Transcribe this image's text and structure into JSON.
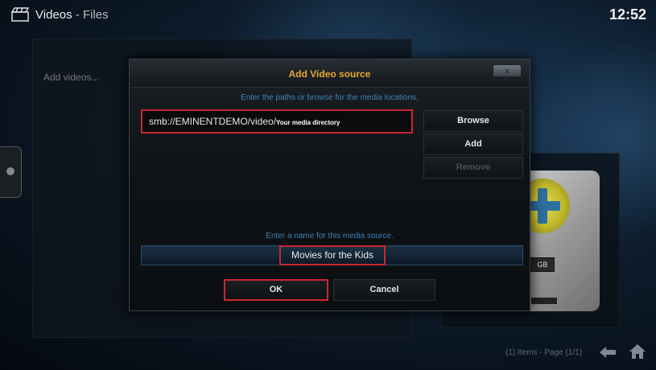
{
  "header": {
    "section": "Videos",
    "separator": " - ",
    "subsection": "Files",
    "clock": "12:52"
  },
  "left_panel": {
    "hint": "Add videos..."
  },
  "right_card": {
    "drive_label": "GB"
  },
  "footer": {
    "items_info": "(1) Items - Page (1/1)"
  },
  "dialog": {
    "title": "Add Video source",
    "close_label": "x",
    "instructions": "Enter the paths or browse for the media locations.",
    "path_value": "smb://EMINENTDEMO/video/",
    "path_annotation": "Your media directory",
    "browse_label": "Browse",
    "add_label": "Add",
    "remove_label": "Remove",
    "name_instructions": "Enter a name for this media source.",
    "name_value": "Movies for the Kids",
    "ok_label": "OK",
    "cancel_label": "Cancel"
  },
  "colors": {
    "accent": "#e8a732",
    "highlight": "#c8282e",
    "instruction_text": "#3d82b7"
  }
}
